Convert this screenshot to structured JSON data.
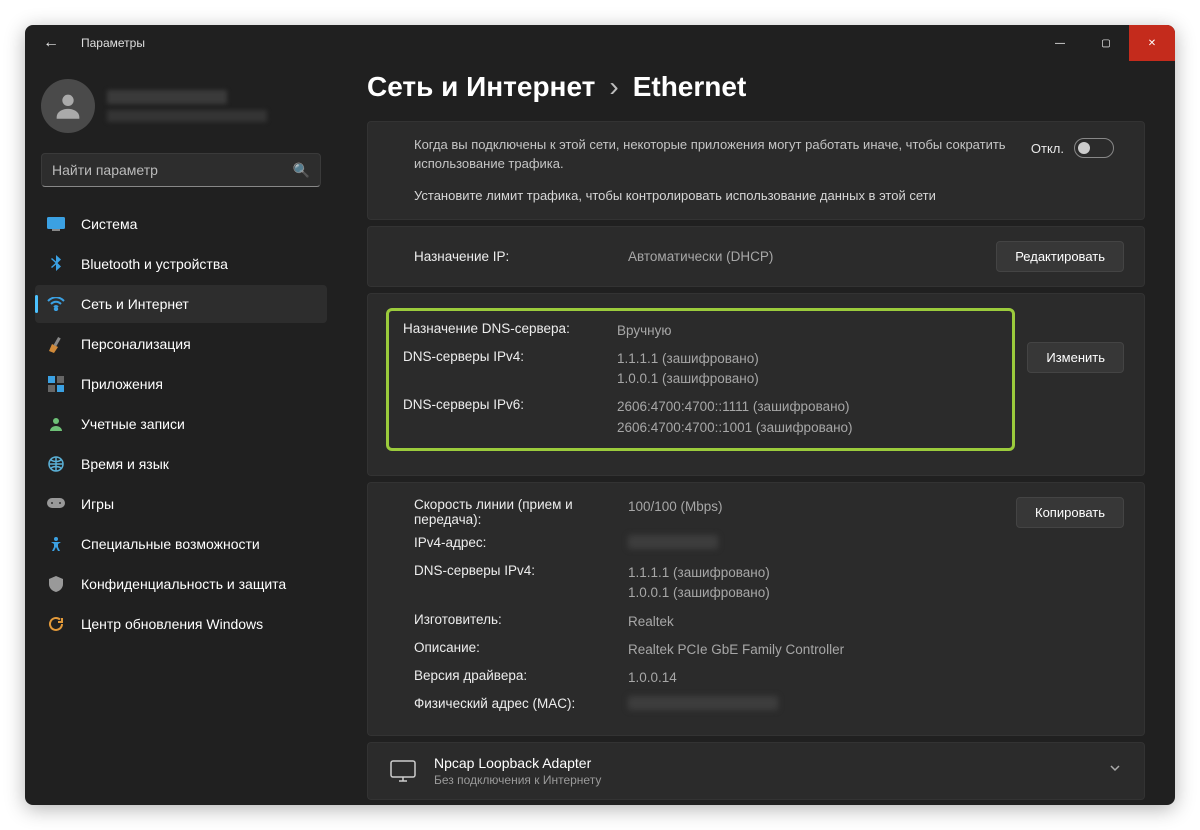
{
  "window": {
    "title": "Параметры"
  },
  "search": {
    "placeholder": "Найти параметр"
  },
  "sidebar": {
    "items": [
      {
        "label": "Система"
      },
      {
        "label": "Bluetooth и устройства"
      },
      {
        "label": "Сеть и Интернет"
      },
      {
        "label": "Персонализация"
      },
      {
        "label": "Приложения"
      },
      {
        "label": "Учетные записи"
      },
      {
        "label": "Время и язык"
      },
      {
        "label": "Игры"
      },
      {
        "label": "Специальные возможности"
      },
      {
        "label": "Конфиденциальность и защита"
      },
      {
        "label": "Центр обновления Windows"
      }
    ]
  },
  "breadcrumb": {
    "parent": "Сеть и Интернет",
    "sep": "›",
    "page": "Ethernet"
  },
  "metered": {
    "desc": "Когда вы подключены к этой сети, некоторые приложения могут работать иначе, чтобы сократить использование трафика.",
    "limit": "Установите лимит трафика, чтобы контролировать использование данных в этой сети",
    "state": "Откл."
  },
  "ip": {
    "label": "Назначение IP:",
    "value": "Автоматически (DHCP)",
    "edit": "Редактировать"
  },
  "dns": {
    "assign_k": "Назначение DNS-сервера:",
    "assign_v": "Вручную",
    "ipv4_k": "DNS-серверы IPv4:",
    "ipv4_v1": "1.1.1.1 (зашифровано)",
    "ipv4_v2": "1.0.0.1 (зашифровано)",
    "ipv6_k": "DNS-серверы IPv6:",
    "ipv6_v1": "2606:4700:4700::1111 (зашифровано)",
    "ipv6_v2": "2606:4700:4700::1001 (зашифровано)",
    "change": "Изменить"
  },
  "details": {
    "speed_k": "Скорость линии (прием и передача):",
    "speed_v": "100/100 (Mbps)",
    "ipv4addr_k": "IPv4-адрес:",
    "dns4_k": "DNS-серверы IPv4:",
    "dns4_v1": "1.1.1.1 (зашифровано)",
    "dns4_v2": "1.0.0.1 (зашифровано)",
    "mfr_k": "Изготовитель:",
    "mfr_v": "Realtek",
    "desc_k": "Описание:",
    "desc_v": "Realtek PCIe GbE Family Controller",
    "drv_k": "Версия драйвера:",
    "drv_v": "1.0.0.14",
    "mac_k": "Физический адрес (MAC):",
    "copy": "Копировать"
  },
  "adapter": {
    "title": "Npcap Loopback Adapter",
    "sub": "Без подключения к Интернету"
  }
}
